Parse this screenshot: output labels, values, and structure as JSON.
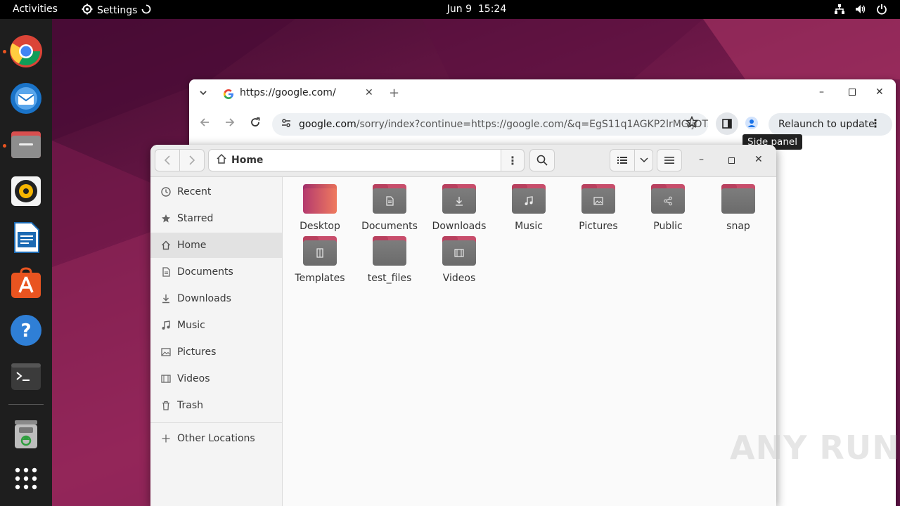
{
  "topbar": {
    "activities": "Activities",
    "app_name": "Settings",
    "date": "Jun 9",
    "time": "15:24"
  },
  "dock": {
    "items": [
      "Google Chrome",
      "Thunderbird",
      "Files",
      "Rhythmbox",
      "LibreOffice Writer",
      "Ubuntu Software",
      "Help",
      "Terminal",
      "Trash",
      "Show Applications"
    ]
  },
  "chrome": {
    "tab_title": "https://google.com/",
    "url_host": "google.com",
    "url_rest": "/sorry/index?continue=https://google.com/&q=EgS11q1AGKP2lrMGIjDT...",
    "relaunch_label": "Relaunch to update",
    "tooltip": "Side panel"
  },
  "files": {
    "path_label": "Home",
    "sidebar": [
      {
        "label": "Recent",
        "icon": "clock-icon"
      },
      {
        "label": "Starred",
        "icon": "star-icon"
      },
      {
        "label": "Home",
        "icon": "home-icon",
        "active": true
      },
      {
        "label": "Documents",
        "icon": "document-icon"
      },
      {
        "label": "Downloads",
        "icon": "download-icon"
      },
      {
        "label": "Music",
        "icon": "music-icon"
      },
      {
        "label": "Pictures",
        "icon": "picture-icon"
      },
      {
        "label": "Videos",
        "icon": "video-icon"
      },
      {
        "label": "Trash",
        "icon": "trash-icon"
      },
      {
        "label": "Other Locations",
        "icon": "plus-icon"
      }
    ],
    "folders": [
      {
        "label": "Desktop",
        "emblem": "desktop"
      },
      {
        "label": "Documents",
        "emblem": "document"
      },
      {
        "label": "Downloads",
        "emblem": "download"
      },
      {
        "label": "Music",
        "emblem": "music"
      },
      {
        "label": "Pictures",
        "emblem": "picture"
      },
      {
        "label": "Public",
        "emblem": "share"
      },
      {
        "label": "snap",
        "emblem": "none"
      },
      {
        "label": "Templates",
        "emblem": "template"
      },
      {
        "label": "test_files",
        "emblem": "none"
      },
      {
        "label": "Videos",
        "emblem": "video"
      }
    ]
  },
  "watermark": "ANY RUN",
  "colors": {
    "ubuntu_orange": "#e95420",
    "folder_accent": "#c84d6b"
  }
}
